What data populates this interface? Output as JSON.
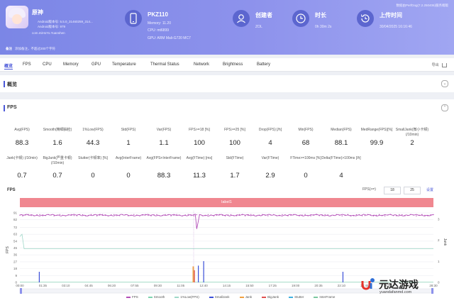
{
  "header": {
    "app": {
      "name": "原神",
      "android_version": "Android版本号: 5.5.0_31460259_314...",
      "android_code": "Android版本号: 979",
      "package": "com.miHoYo.Yuanshen"
    },
    "device": {
      "model": "PKZ110",
      "memory": "Memory: 11.20",
      "cpu": "CPU: mt6899",
      "gpu": "GPU: ARM Mali-G720 MC7"
    },
    "creator": {
      "title": "创建者",
      "value": "ZOL"
    },
    "duration": {
      "title": "时长",
      "value": "0h 30m 2s"
    },
    "upload": {
      "title": "上传时间",
      "value": "30/04/2025 16:16:46"
    },
    "tool_note": "数据由PerfDog(7.2.250406)服务端版",
    "remark_label": "备注",
    "remark_text": "添加备注，不超过200个字符"
  },
  "tabs": {
    "items": [
      "概览",
      "FPS",
      "CPU",
      "Memory",
      "GPU",
      "Temperature",
      "Thermal Status",
      "Network",
      "Brightness",
      "Battery"
    ],
    "active_index": 0,
    "export_label": "导出"
  },
  "overview": {
    "title": "概览"
  },
  "fps_section": {
    "title": "FPS",
    "row1": [
      {
        "label": "Avg(FPS)",
        "value": "88.3"
      },
      {
        "label": "Smooth(精细抽检)",
        "value": "1.6"
      },
      {
        "label": "1%Low(FPS)",
        "value": "44.3"
      },
      {
        "label": "Std(FPS)",
        "value": "1"
      },
      {
        "label": "Var(FPS)",
        "value": "1.1"
      },
      {
        "label": "FPS>=18 [%]",
        "value": "100"
      },
      {
        "label": "FPS>=25 [%]",
        "value": "100"
      },
      {
        "label": "Drop(FPS) [/h]",
        "value": "4"
      },
      {
        "label": "Min(FPS)",
        "value": "68"
      },
      {
        "label": "Median(FPS)",
        "value": "88.1"
      },
      {
        "label": "MedRange(FPS)[%]",
        "value": "99.9"
      },
      {
        "label": "SmallJank(微小卡顿) (/10min)",
        "value": "2"
      }
    ],
    "row2": [
      {
        "label": "Jank(卡顿) (/10min)",
        "value": "0.7"
      },
      {
        "label": "BigJank(严重卡顿) (/10min)",
        "value": "0.7"
      },
      {
        "label": "Stutter(卡顿率) [%]",
        "value": "0"
      },
      {
        "label": "Avg(InterFrame)",
        "value": "0"
      },
      {
        "label": "Avg(FPS+InterFrame)",
        "value": "88.3"
      },
      {
        "label": "Avg(FTime) [ms]",
        "value": "11.3"
      },
      {
        "label": "Std(FTime)",
        "value": "1.7"
      },
      {
        "label": "Var(FTime)",
        "value": "2.9"
      },
      {
        "label": "FTime>=100ms [%]",
        "value": "0"
      },
      {
        "label": "Delta(FTime)>100ms [/h]",
        "value": "4"
      }
    ]
  },
  "chart": {
    "title": "FPS",
    "fps_filter_label": "FPS(>=)",
    "fps_filter_values": [
      "18",
      "25"
    ],
    "settings_label": "设置",
    "label_bar": "label1",
    "y_axis_left_title": "FPS",
    "y_axis_right_title": "Jank",
    "colors": {
      "fps": "#b34fb8",
      "smooth": "#7fd3b0",
      "low": "#9fd8c9",
      "smalljank": "#3b4fd8",
      "jank": "#f0a040",
      "bigjank": "#e05050",
      "stutter": "#40b0e0",
      "interframe": "#7cc8a0",
      "label": "#f08790"
    },
    "legend": [
      "FPS",
      "Smooth",
      "1%Low(FPS)",
      "SmallJank",
      "Jank",
      "BigJank",
      "Stutter",
      "InterFrame"
    ]
  },
  "chart_data": {
    "type": "line",
    "x": [
      "00:00",
      "01:35",
      "03:10",
      "04:45",
      "06:20",
      "07:55",
      "09:30",
      "11:05",
      "12:40",
      "14:15",
      "15:50",
      "17:25",
      "19:00",
      "20:35",
      "22:10",
      "23:45",
      "25:20",
      "26:55",
      "28:30"
    ],
    "ylim": [
      0,
      91
    ],
    "y_ticks_left": [
      0,
      9,
      18,
      27,
      36,
      45,
      54,
      63,
      72,
      82,
      91
    ],
    "y_ticks_right": [
      0,
      1,
      2,
      3
    ],
    "series": [
      {
        "name": "FPS",
        "values": [
          88,
          88,
          88,
          88,
          88,
          88,
          88,
          88,
          70,
          88,
          88,
          88,
          88,
          88,
          88,
          88,
          88,
          88,
          88
        ]
      },
      {
        "name": "1%Low(FPS)",
        "values": [
          60,
          44,
          44,
          44,
          44,
          44,
          44,
          44,
          44,
          44,
          44,
          44,
          44,
          44,
          44,
          44,
          44,
          44,
          44
        ]
      },
      {
        "name": "Jank",
        "values": [
          0,
          1,
          0,
          0,
          0,
          0,
          0,
          0,
          2,
          0,
          0,
          0,
          0,
          0,
          1,
          0,
          0,
          0,
          0
        ]
      }
    ],
    "legend": [
      "FPS",
      "Smooth",
      "1%Low(FPS)",
      "SmallJank",
      "Jank",
      "BigJank",
      "Stutter",
      "InterFrame"
    ],
    "legend_position": "bottom"
  },
  "watermark": {
    "site_name": "元达游戏",
    "site_url": "yuandafanmd.com"
  }
}
